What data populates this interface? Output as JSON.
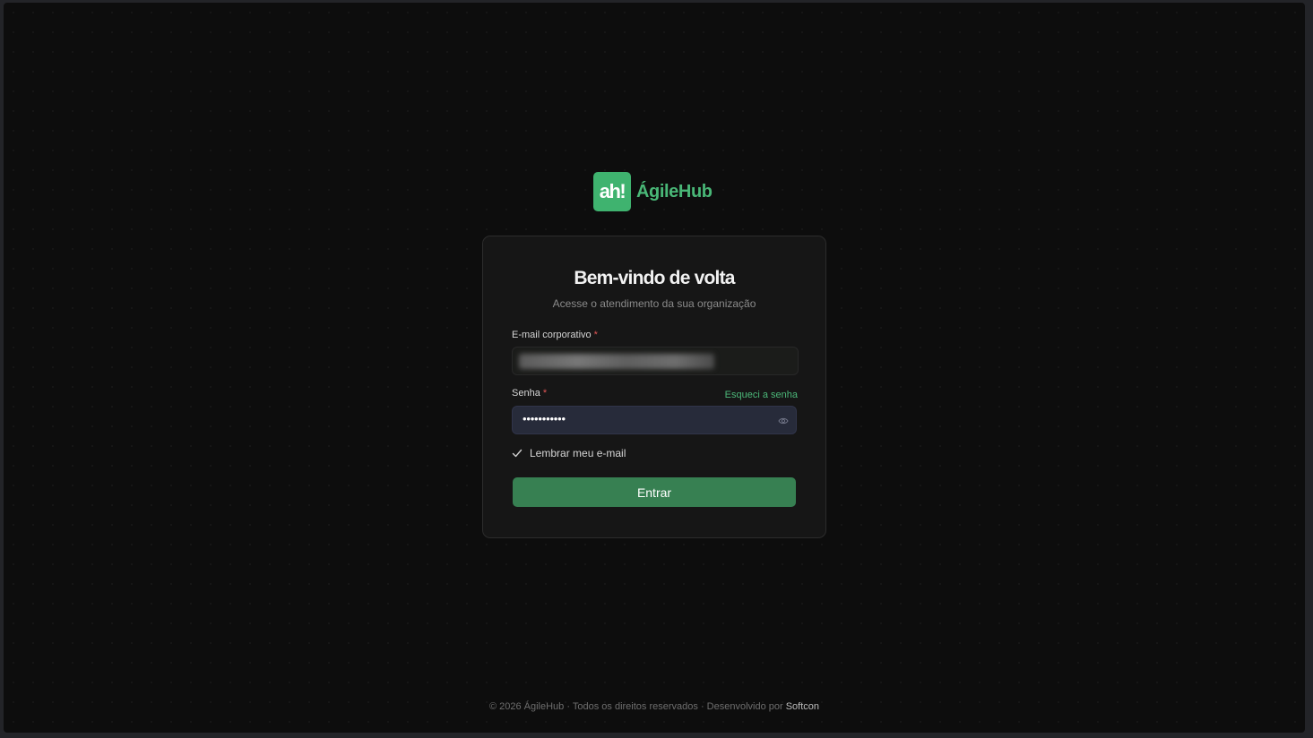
{
  "brand": {
    "logo_mark": "ah!",
    "name": "ÁgileHub",
    "accent_color": "#3fb36f"
  },
  "login": {
    "title": "Bem-vindo de volta",
    "subtitle": "Acesse o atendimento da sua organização",
    "email": {
      "label": "E-mail corporativo",
      "required_marker": "*",
      "value_state": "blurred"
    },
    "password": {
      "label": "Senha",
      "required_marker": "*",
      "value": "•••••••••••",
      "toggle_icon": "eye-icon"
    },
    "forgot_link": "Esqueci a senha",
    "remember": {
      "label": "Lembrar meu e-mail",
      "checked": true,
      "icon": "check-icon"
    },
    "submit_label": "Entrar",
    "submit_color": "#378052"
  },
  "footer": {
    "text": "© 2026 ÁgileHub · Todos os direitos reservados · Desenvolvido por ",
    "company": "Softcon"
  }
}
